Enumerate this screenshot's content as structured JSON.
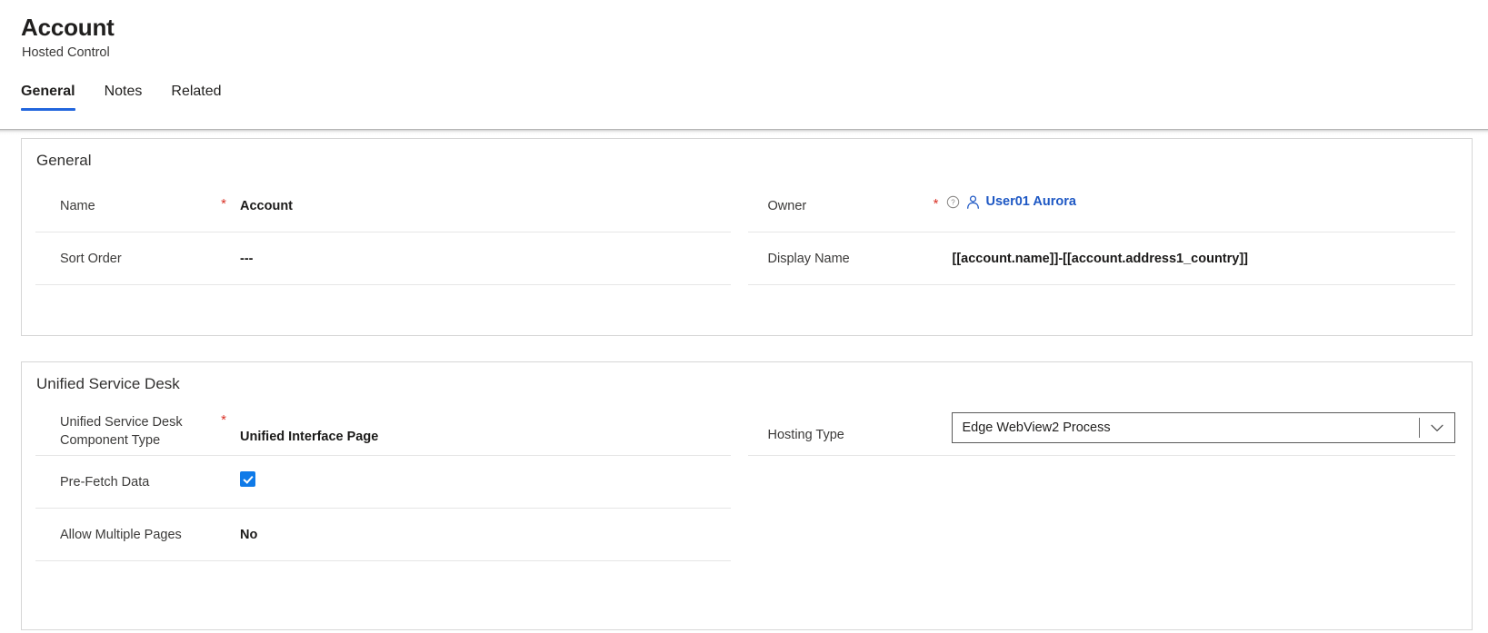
{
  "header": {
    "title": "Account",
    "subtitle": "Hosted Control",
    "tabs": [
      {
        "label": "General",
        "selected": true
      },
      {
        "label": "Notes",
        "selected": false
      },
      {
        "label": "Related",
        "selected": false
      }
    ]
  },
  "sections": {
    "general": {
      "title": "General",
      "fields": {
        "name": {
          "label": "Name",
          "value": "Account",
          "required_marker": "*"
        },
        "sort_order": {
          "label": "Sort Order",
          "value": "---"
        },
        "owner": {
          "label": "Owner",
          "required_marker": "*",
          "value": "User01 Aurora",
          "info_icon": "help-circle-icon",
          "user_icon": "person-icon"
        },
        "display_name": {
          "label": "Display Name",
          "value": "[[account.name]]-[[account.address1_country]]"
        }
      }
    },
    "unified_service_desk": {
      "title": "Unified Service Desk",
      "fields": {
        "component_type": {
          "label": "Unified Service Desk Component Type",
          "label_line1": "Unified Service Desk",
          "label_line2": "Component Type",
          "required_marker": "*",
          "value": "Unified Interface Page"
        },
        "pre_fetch_data": {
          "label": "Pre-Fetch Data",
          "checked": true
        },
        "allow_multiple_pages": {
          "label": "Allow Multiple Pages",
          "value": "No"
        },
        "hosting_type": {
          "label": "Hosting Type",
          "value": "Edge WebView2 Process",
          "chevron_icon": "chevron-down-icon"
        }
      }
    }
  },
  "colors": {
    "accent_blue": "#2266dd",
    "link_blue": "#1e58c4",
    "required_red": "#d93025",
    "checkbox_blue": "#0f7ae8",
    "card_border": "#d6d6d6",
    "row_divider": "#e6e6e6"
  }
}
